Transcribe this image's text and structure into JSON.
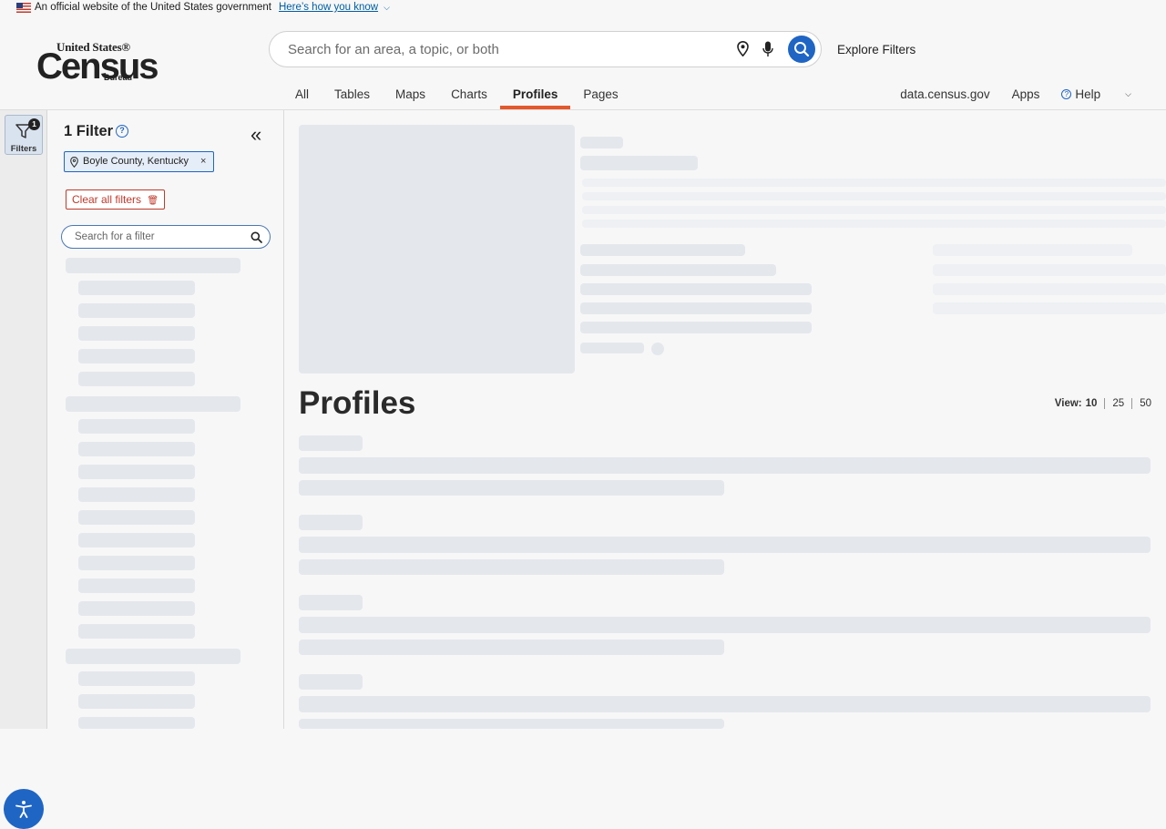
{
  "banner": {
    "text": "An official website of the United States government",
    "link": "Here’s how you know"
  },
  "logo": {
    "line1": "United States®",
    "line2": "Census",
    "line3": "Bureau"
  },
  "search": {
    "placeholder": "Search for an area, a topic, or both"
  },
  "explore_filters": "Explore Filters",
  "tabs": [
    "All",
    "Tables",
    "Maps",
    "Charts",
    "Profiles",
    "Pages"
  ],
  "active_tab": "Profiles",
  "right_links": {
    "data": "data.census.gov",
    "apps": "Apps",
    "help": "Help"
  },
  "rail": {
    "filters_label": "Filters",
    "badge": "1"
  },
  "filter_panel": {
    "title": "1 Filter",
    "chip": "Boyle County, Kentucky",
    "clear": "Clear all filters",
    "search_placeholder": "Search for a filter"
  },
  "main": {
    "title": "Profiles",
    "view_label": "View:",
    "view_options": [
      "10",
      "25",
      "50"
    ],
    "view_selected": "10"
  },
  "colors": {
    "accent": "#e5582b",
    "primary": "#1f65c4",
    "clear_red": "#c0392b"
  }
}
